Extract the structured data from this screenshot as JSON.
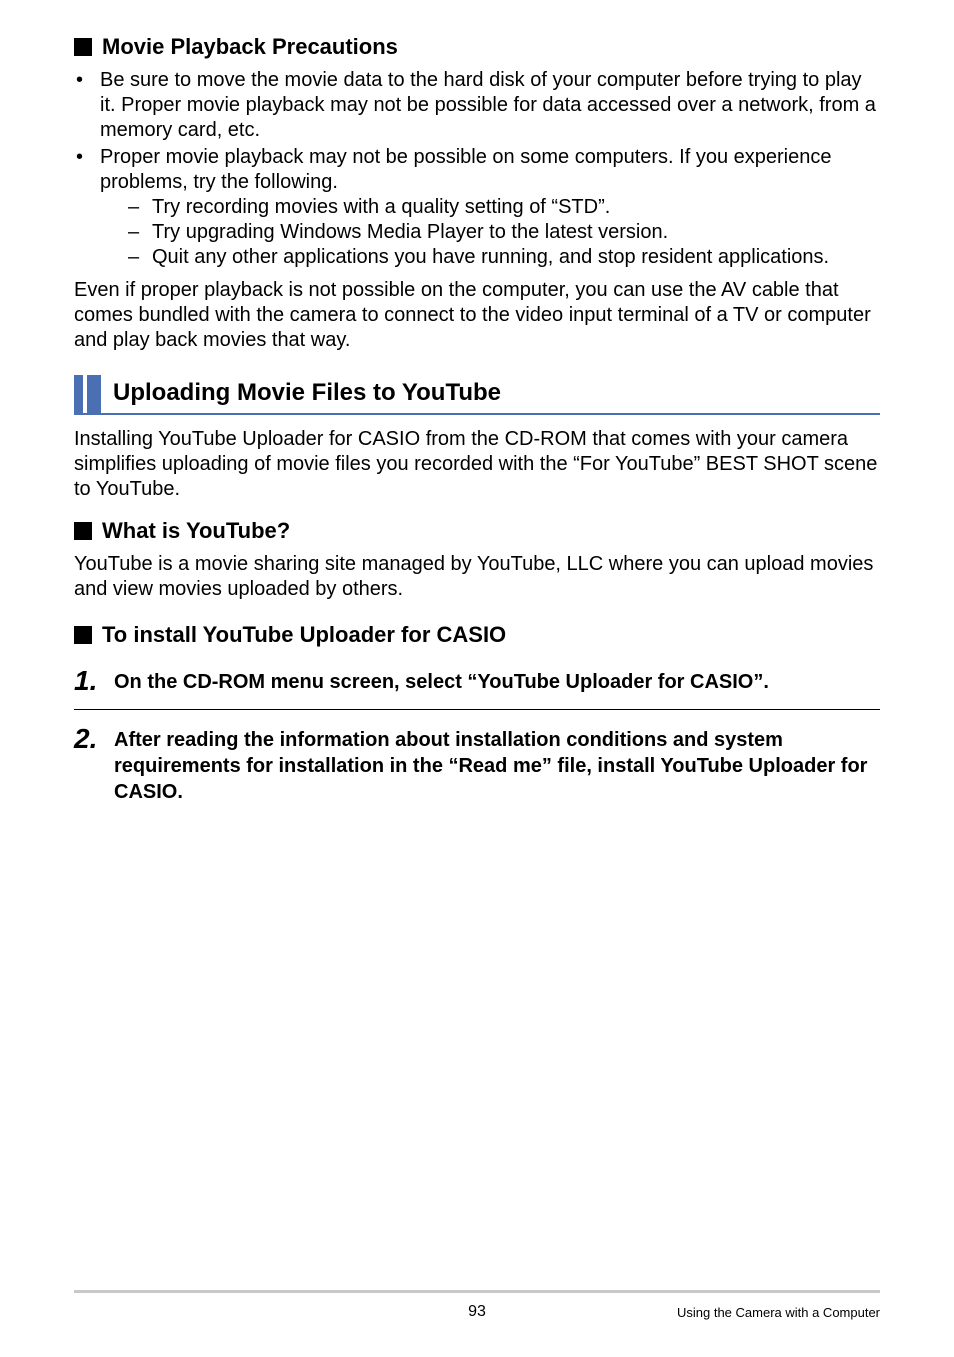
{
  "headings": {
    "movie_precautions": "Movie Playback Precautions",
    "uploading": "Uploading Movie Files to YouTube",
    "what_is_youtube": "What is YouTube?",
    "install_uploader": "To install YouTube Uploader for CASIO"
  },
  "bullets": {
    "b1": "Be sure to move the movie data to the hard disk of your computer before trying to play it. Proper movie playback may not be possible for data accessed over a network, from a memory card, etc.",
    "b2": "Proper movie playback may not be possible on some computers. If you experience problems, try the following.",
    "d1": "Try recording movies with a quality setting of “STD”.",
    "d2": "Try upgrading Windows Media Player to the latest version.",
    "d3": "Quit any other applications you have running, and stop resident applications."
  },
  "paras": {
    "p_av": "Even if proper playback is not possible on the computer, you can use the AV cable that comes bundled with the camera to connect to the video input terminal of a TV or computer and play back movies that way.",
    "p_upload_intro": "Installing YouTube Uploader for CASIO from the CD-ROM that comes with your camera simplifies uploading of movie files you recorded with the “For YouTube” BEST SHOT scene to YouTube.",
    "p_what_is": "YouTube is a movie sharing site managed by YouTube, LLC where you can upload movies and view movies uploaded by others."
  },
  "steps": {
    "s1_num": "1.",
    "s1_text": "On the CD-ROM menu screen, select “YouTube Uploader for CASIO”.",
    "s2_num": "2.",
    "s2_text": "After reading the information about installation conditions and system requirements for installation in the “Read me” file, install YouTube Uploader for CASIO."
  },
  "footer": {
    "page_num": "93",
    "section": "Using the Camera with a Computer"
  }
}
